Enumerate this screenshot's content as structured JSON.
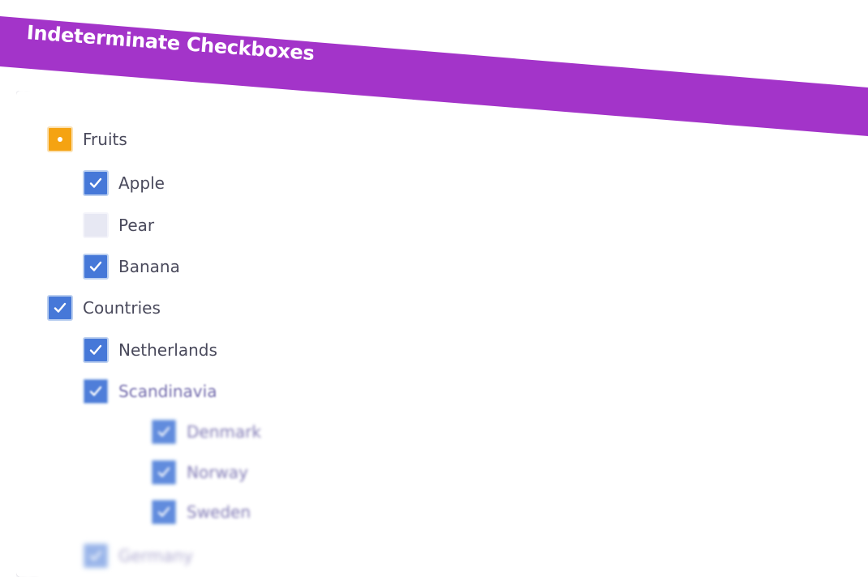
{
  "header": {
    "title": "Indeterminate Checkboxes"
  },
  "tree": {
    "fruits": {
      "label": "Fruits",
      "state": "indeterminate",
      "children": {
        "apple": {
          "label": "Apple",
          "state": "checked"
        },
        "pear": {
          "label": "Pear",
          "state": "unchecked"
        },
        "banana": {
          "label": "Banana",
          "state": "checked"
        }
      }
    },
    "countries": {
      "label": "Countries",
      "state": "checked",
      "children": {
        "netherlands": {
          "label": "Netherlands",
          "state": "checked"
        },
        "scandinavia": {
          "label": "Scandinavia",
          "state": "checked",
          "children": {
            "denmark": {
              "label": "Denmark",
              "state": "checked"
            },
            "norway": {
              "label": "Norway",
              "state": "checked"
            },
            "sweden": {
              "label": "Sweden",
              "state": "checked"
            }
          }
        },
        "germany": {
          "label": "Germany",
          "state": "checked"
        }
      }
    }
  },
  "colors": {
    "banner": "#a334c9",
    "checked": "#4678d8",
    "indeterminate": "#f5a312",
    "unchecked": "#e7e8f3"
  }
}
